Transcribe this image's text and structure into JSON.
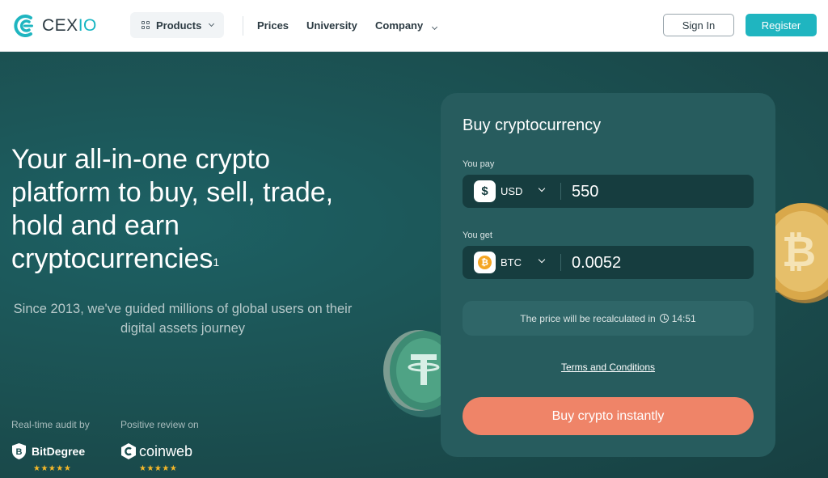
{
  "colors": {
    "accent": "#1fb5c0",
    "buy_button": "#ef8468",
    "hero_bg": "#1b4f50",
    "card_bg": "#275c5e",
    "star": "#f5b829"
  },
  "header": {
    "logo": {
      "text_main": "CEX",
      "text_suffix": "IO"
    },
    "products_label": "Products",
    "nav": [
      "Prices",
      "University",
      "Company"
    ],
    "sign_in": "Sign In",
    "register": "Register"
  },
  "hero": {
    "headline": "Your all-in-one crypto platform to buy, sell, trade, hold and earn cryptocurrencies",
    "headline_sup": "1",
    "subtext": "Since 2013, we've guided millions of global users on their digital assets journey",
    "audit": {
      "label": "Real-time audit by",
      "brand": "BitDegree",
      "rating": 4.5,
      "stars": "★★★★★"
    },
    "review": {
      "label": "Positive review on",
      "brand": "coinweb",
      "rating": 4.5,
      "stars": "★★★★★"
    }
  },
  "buy_card": {
    "title": "Buy cryptocurrency",
    "pay": {
      "label": "You pay",
      "icon": "dollar-icon",
      "icon_glyph": "$",
      "currency": "USD",
      "amount": "550"
    },
    "get": {
      "label": "You get",
      "icon": "bitcoin-icon",
      "icon_glyph": "₿",
      "currency": "BTC",
      "amount": "0.0052"
    },
    "recalc_text": "The price will be recalculated in",
    "timer": "14:51",
    "terms": "Terms and Conditions",
    "buy_button": "Buy crypto instantly"
  }
}
